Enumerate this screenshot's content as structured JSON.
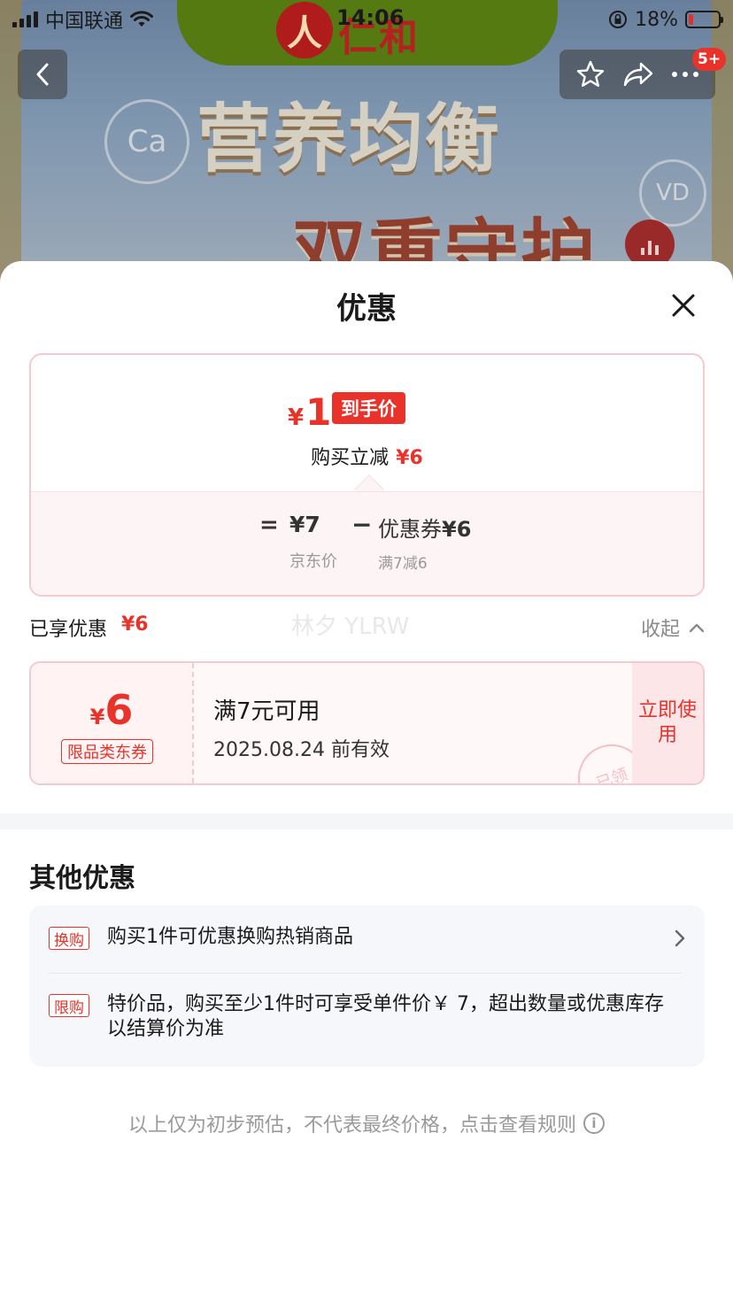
{
  "status_bar": {
    "carrier": "中国联通",
    "time": "14:06",
    "battery": "18%"
  },
  "banner": {
    "brand_logo": "人",
    "brand_name": "仁和",
    "headline_1": "营养均衡",
    "headline_2": "双重守护",
    "bubble_1": "Ca",
    "bubble_2": "VD"
  },
  "nav": {
    "badge": "5+"
  },
  "sheet": {
    "title": "优惠",
    "final_price": {
      "currency": "¥",
      "value": "1",
      "tag": "到手价"
    },
    "instant_cut": {
      "label": "购买立减",
      "amount": "¥6"
    },
    "breakdown": {
      "eq": "=",
      "jd_price": "¥7",
      "jd_label": "京东价",
      "minus": "−",
      "coupon_label": "优惠券",
      "coupon_amount": "¥6",
      "coupon_condition": "满7减6"
    },
    "enjoyed": {
      "label": "已享优惠",
      "amount": "¥6",
      "watermark": "林夕 YLRW",
      "collapse": "收起"
    },
    "coupon": {
      "currency": "¥",
      "value": "6",
      "type": "限品类东券",
      "condition": "满7元可用",
      "expire": "2025.08.24 前有效",
      "use_button": "立即使用",
      "stamp": "已领"
    },
    "other": {
      "title": "其他优惠",
      "items": [
        {
          "tag": "换购",
          "text": "购买1件可优惠换购热销商品"
        },
        {
          "tag": "限购",
          "text": "特价品，购买至少1件时可享受单件价￥ 7，超出数量或优惠库存以结算价为准"
        }
      ]
    },
    "disclaimer": "以上仅为初步预估，不代表最终价格，点击查看规则"
  },
  "colors": {
    "accent": "#e8322a",
    "card_border": "#f6c9cf",
    "coupon_bg": "#fff8f8"
  }
}
